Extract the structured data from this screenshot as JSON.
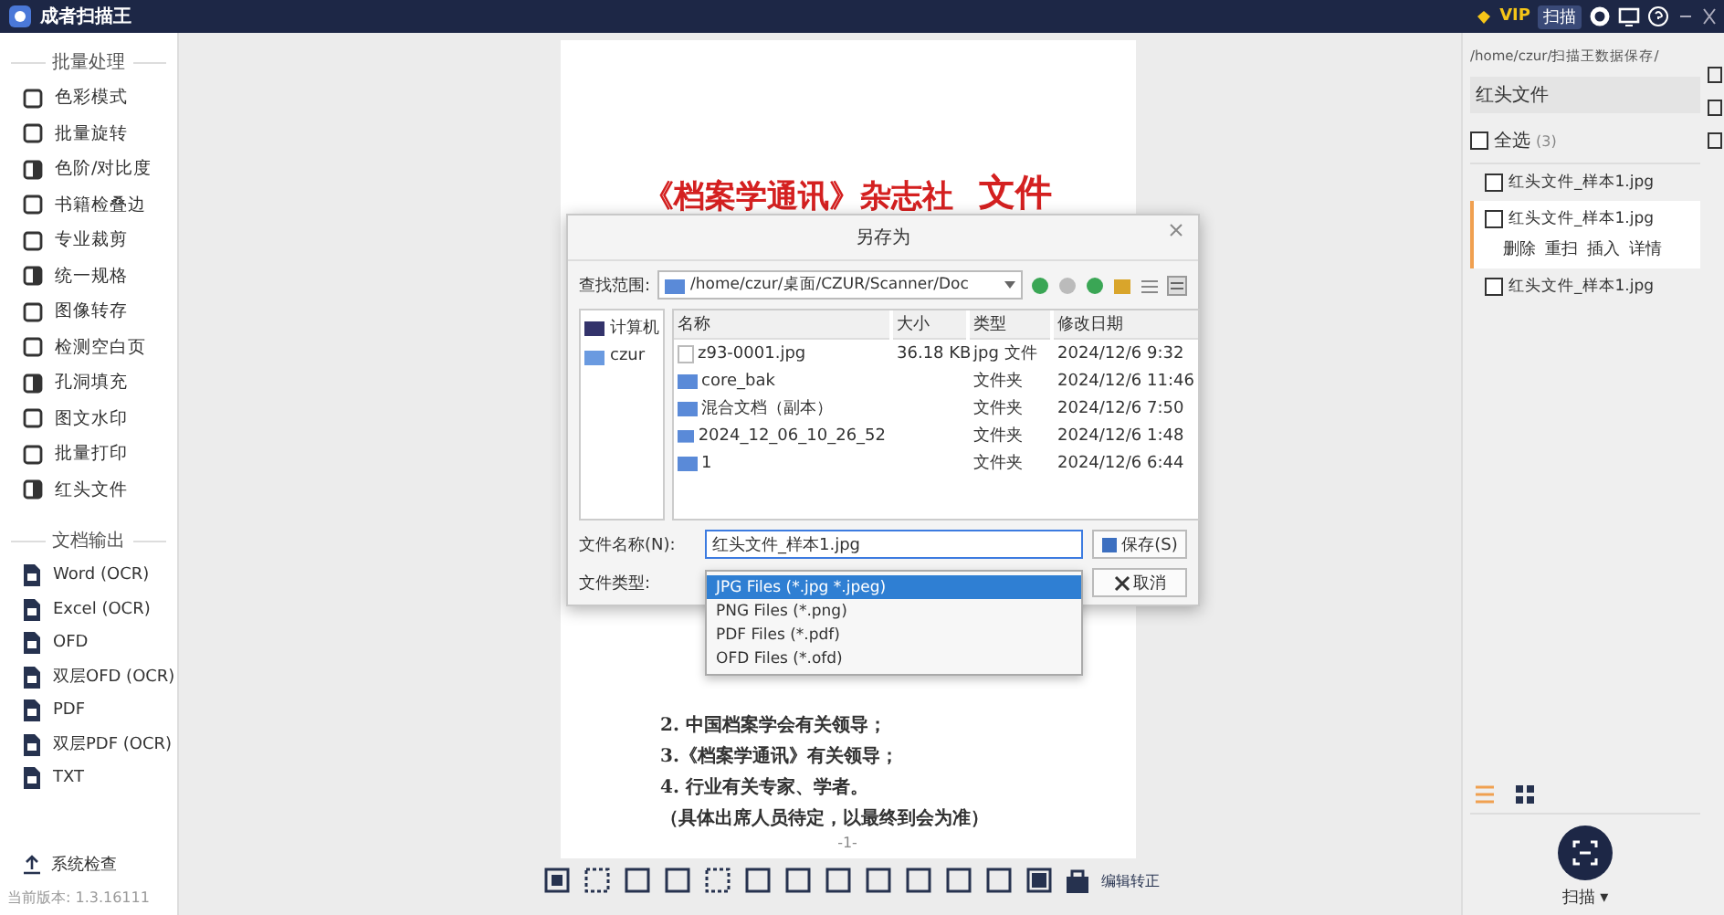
{
  "app": {
    "title": "成者扫描王"
  },
  "topbar": {
    "vip": "VIP",
    "scan": "扫描"
  },
  "sidebar": {
    "sections": [
      {
        "heading": "批量处理",
        "items": [
          "色彩模式",
          "批量旋转",
          "色阶/对比度",
          "书籍检叠边",
          "专业裁剪",
          "统一规格",
          "图像转存",
          "检测空白页",
          "孔洞填充",
          "图文水印",
          "批量打印",
          "红头文件"
        ]
      },
      {
        "heading": "文档输出",
        "items": [
          "Word (OCR)",
          "Excel (OCR)",
          "OFD",
          "双层OFD (OCR)",
          "PDF",
          "双层PDF (OCR)",
          "TXT"
        ]
      }
    ],
    "footer_link": "系统检查",
    "version": "当前版本: 1.3.16111"
  },
  "document": {
    "title": "《档案学通讯》杂志社",
    "title_suffix": "文件",
    "lines": [
      "2. 中国档案学会有关领导；",
      "3.《档案学通讯》有关领导；",
      "4. 行业有关专家、学者。",
      "（具体出席人员待定，以最终到会为准）"
    ],
    "page_number": "-1-"
  },
  "dialog": {
    "title": "另存为",
    "lookin_label": "查找范围:",
    "path": "/home/czur/桌面/CZUR/Scanner/Doc",
    "places": [
      "计算机",
      "czur"
    ],
    "columns": [
      "名称",
      "大小",
      "类型",
      "修改日期"
    ],
    "rows": [
      {
        "kind": "file",
        "name": "z93-0001.jpg",
        "size": "36.18 KB",
        "type": "jpg 文件",
        "date": "2024/12/6 9:32"
      },
      {
        "kind": "folder",
        "name": "core_bak",
        "size": "",
        "type": "文件夹",
        "date": "2024/12/6 11:46"
      },
      {
        "kind": "folder",
        "name": "混合文档（副本）",
        "size": "",
        "type": "文件夹",
        "date": "2024/12/6 7:50"
      },
      {
        "kind": "folder",
        "name": "2024_12_06_10_26_52",
        "size": "",
        "type": "文件夹",
        "date": "2024/12/6 1:48"
      },
      {
        "kind": "folder",
        "name": "1",
        "size": "",
        "type": "文件夹",
        "date": "2024/12/6 6:44"
      }
    ],
    "filename_label": "文件名称(N):",
    "filename": "红头文件_样本1.jpg",
    "save": "保存(S)",
    "filetype_label": "文件类型:",
    "cancel": "取消",
    "filetypes": [
      {
        "label": "JPG Files (*.jpg *.jpeg)",
        "selected": true
      },
      {
        "label": "PNG Files (*.png)",
        "selected": false
      },
      {
        "label": "PDF Files (*.pdf)",
        "selected": false
      },
      {
        "label": "OFD Files (*.ofd)",
        "selected": false
      }
    ]
  },
  "right_panel": {
    "path": "/home/czur/扫描王数据保存/",
    "folder": "红头文件",
    "select_all": {
      "label": "全选",
      "count": "(3)",
      "checked": false
    },
    "files": [
      {
        "name": "红头文件_样本1.jpg",
        "checked": false,
        "selected": false
      },
      {
        "name": "红头文件_样本1.jpg",
        "checked": false,
        "selected": true,
        "actions": [
          "删除",
          "重扫",
          "插入",
          "详情"
        ]
      },
      {
        "name": "红头文件_样本1.jpg",
        "checked": false,
        "selected": false
      }
    ],
    "views": [
      {
        "kind": "list",
        "selected": true
      },
      {
        "kind": "grid",
        "selected": false
      }
    ],
    "scan_button": "扫描 ▾"
  },
  "toolbar": {
    "label": "编辑转正"
  }
}
